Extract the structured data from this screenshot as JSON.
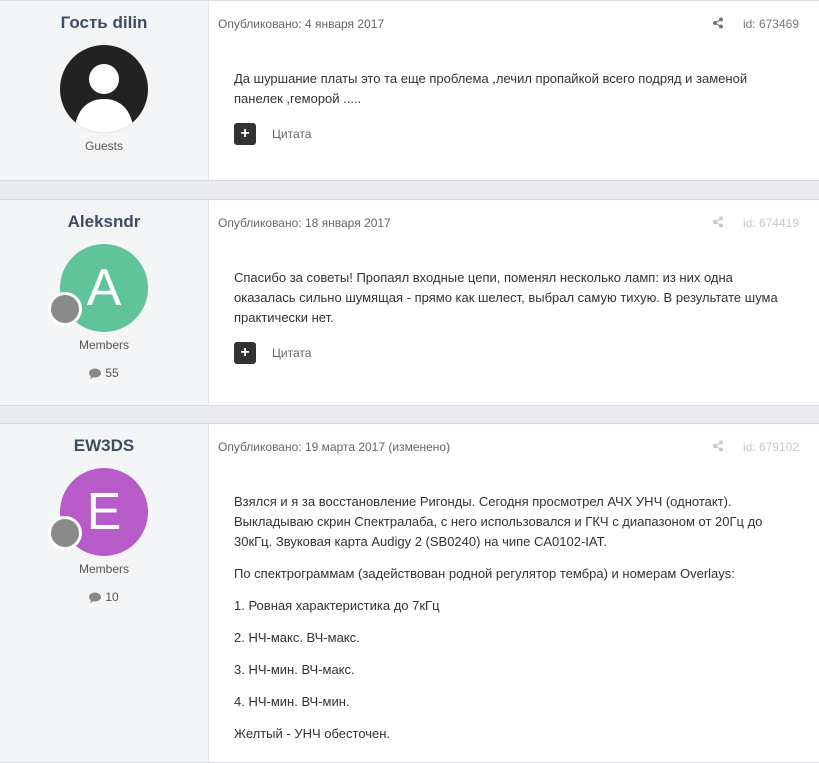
{
  "posts": [
    {
      "author": "Гость dilin",
      "group": "Guests",
      "published": "Опубликовано: 4 января 2017",
      "post_id": "id: 673469",
      "body": [
        "Да шуршание платы это та еще проблема ,лечил пропайкой всего подряд и заменой панелек ,геморой ....."
      ],
      "quote_label": "Цитата"
    },
    {
      "author": "Aleksndr",
      "avatar_letter": "A",
      "avatar_color": "#5fc49a",
      "group": "Members",
      "count": "55",
      "published": "Опубликовано: 18 января 2017",
      "post_id": "id: 674419",
      "body": [
        "Спасибо за советы! Пропаял входные цепи, поменял несколько ламп: из них одна оказалась сильно шумящая - прямо как шелест, выбрал самую тихую. В результате шума практически нет."
      ],
      "quote_label": "Цитата"
    },
    {
      "author": "EW3DS",
      "avatar_letter": "E",
      "avatar_color": "#b75bc9",
      "group": "Members",
      "count": "10",
      "published": "Опубликовано: 19 марта 2017 (изменено)",
      "post_id": "id: 679102",
      "body": [
        "Взялся и я за восстановление Ригонды. Сегодня просмотрел АЧХ УНЧ (однотакт). Выкладываю скрин Спектралаба, с него использовался и ГКЧ с диапазоном от 20Гц до 30кГц. Звуковая карта Audigy 2 (SB0240) на чипе CA0102-IAT.",
        "По спектрограммам (задействован родной регулятор тембра) и номерам Overlays:",
        "1. Ровная характеристика до 7кГц",
        "2. НЧ-макс. ВЧ-макс.",
        "3. НЧ-мин. ВЧ-макс.",
        "4. НЧ-мин. ВЧ-мин.",
        "Желтый - УНЧ обесточен."
      ]
    }
  ]
}
